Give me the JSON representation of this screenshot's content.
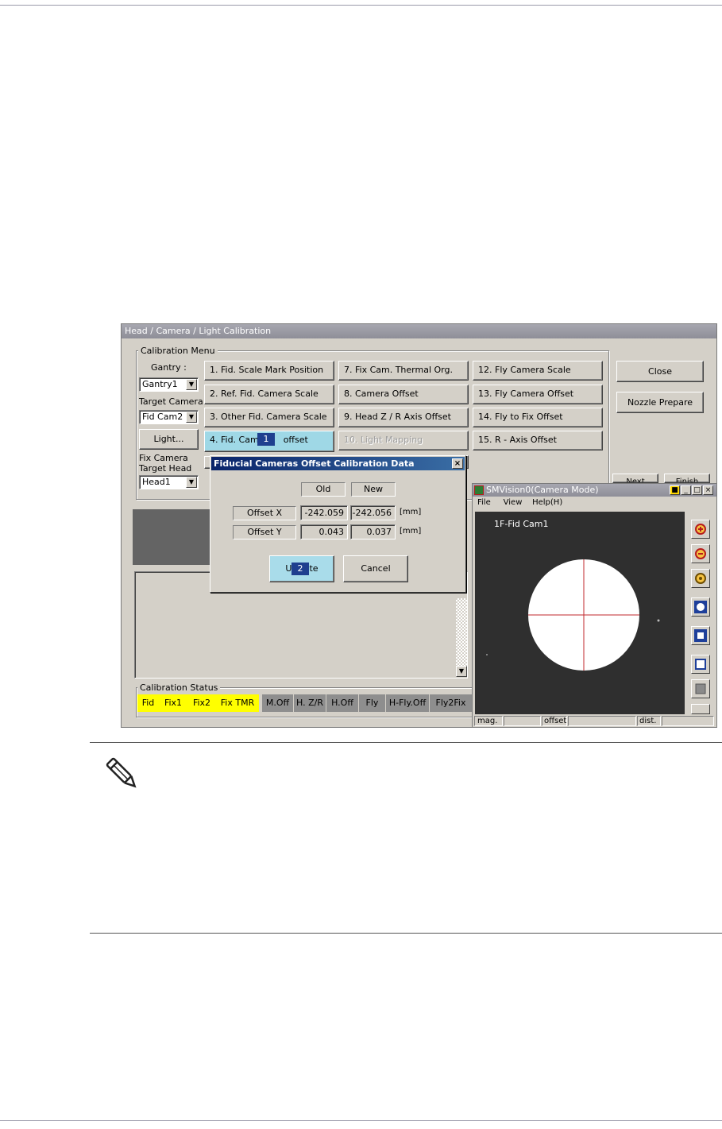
{
  "window": {
    "title": "Head / Camera / Light Calibration",
    "calibration_menu_label": "Calibration Menu",
    "gantry_label": "Gantry :",
    "gantry_value": "Gantry1",
    "target_camera_label": "Target Camera",
    "target_camera_value": "Fid Cam2",
    "light_button": "Light...",
    "fix_camera_label": "Fix Camera",
    "target_head_label": "Target Head",
    "target_head_value": "Head1",
    "menu_buttons": [
      "1. Fid. Scale Mark Position",
      "2. Ref. Fid. Camera Scale",
      "3. Other Fid. Camera Scale",
      "4. Fid. Cam",
      "7. Fix Cam. Thermal Org.",
      "8. Camera Offset",
      "9. Head Z / R Axis Offset",
      "10. Light Mapping",
      "12. Fly Camera Scale",
      "13. Fly Camera Offset",
      "14. Fly to Fix Offset",
      "15. R - Axis Offset"
    ],
    "menu_button_4_suffix": "offset",
    "close_button": "Close",
    "nozzle_prepare_button": "Nozzle Prepare",
    "next_button": "Next",
    "finish_button": "Finish",
    "calibration_status_label": "Calibration Status",
    "status_items": [
      {
        "label": "Fid",
        "color": "#ffff00"
      },
      {
        "label": "Fix1",
        "color": "#ffff00"
      },
      {
        "label": "Fix2",
        "color": "#ffff00"
      },
      {
        "label": "Fix TMR",
        "color": "#ffff00"
      },
      {
        "label": "M.Off",
        "color": "#8e8e8e"
      },
      {
        "label": "H. Z/R",
        "color": "#8e8e8e"
      },
      {
        "label": "H.Off",
        "color": "#8e8e8e"
      },
      {
        "label": "Fly",
        "color": "#8e8e8e"
      },
      {
        "label": "H-Fly.Off",
        "color": "#8e8e8e"
      },
      {
        "label": "Fly2Fix",
        "color": "#8e8e8e"
      }
    ]
  },
  "dialog": {
    "title": "Fiducial Cameras Offset Calibration Data",
    "close_glyph": "×",
    "col_old": "Old",
    "col_new": "New",
    "rows": [
      {
        "label": "Offset X",
        "old": "-242.059",
        "new": "-242.056",
        "unit": "[mm]"
      },
      {
        "label": "Offset Y",
        "old": "0.043",
        "new": "0.037",
        "unit": "[mm]"
      }
    ],
    "update_prefix": "U",
    "update_suffix": "te",
    "cancel_button": "Cancel"
  },
  "badges": {
    "one": "1",
    "two": "2"
  },
  "vision": {
    "title": "SMVision0(Camera Mode)",
    "menu": [
      "File",
      "View",
      "Help(H)"
    ],
    "overlay_text": "1F-Fid Cam1",
    "status_fields": [
      "mag.",
      "offset",
      "dist."
    ],
    "tools": [
      "zoom-in-icon",
      "zoom-out-icon",
      "zoom-fit-icon",
      "fullscreen-icon",
      "restore-icon",
      "window-icon",
      "square-icon",
      "more-icon"
    ]
  }
}
